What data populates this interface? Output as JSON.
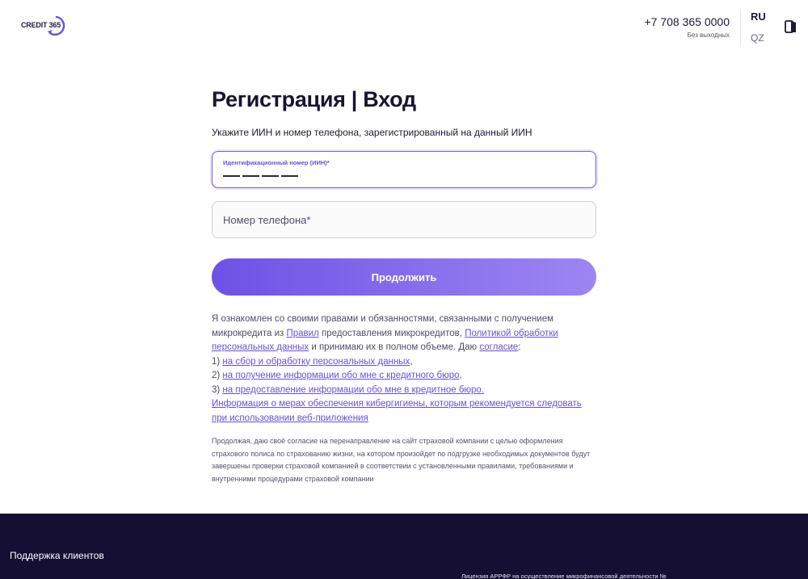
{
  "header": {
    "logo_text": "CREDIT",
    "logo_number": "365",
    "phone_number": "+7 708 365 0000",
    "phone_hours": "Без выходных",
    "lang_ru": "RU",
    "lang_qz": "QZ",
    "icon": "login-door-icon"
  },
  "main": {
    "title": "Регистрация | Вход",
    "subtitle": "Укажите ИИН и номер телефона, зарегистрированный на данный ИИН",
    "iin_label": "Идентификационный номер (ИИН)*",
    "phone_placeholder": "Номер телефона*",
    "continue_button": "Продолжить"
  },
  "consent": {
    "t1": "Я ознакомлен со своими правами и обязанностями, связанными с получением микрокредита из ",
    "link_rules": "Правил",
    "t2": " предоставления микрокредитов, ",
    "link_policy": "Политикой обработки персональных данных",
    "t3": " и принимаю их в полном объеме. Даю ",
    "link_consent": "согласие",
    "t4": ":",
    "item1_num": "1) ",
    "item1_link": "на сбор и обработку персональных данных",
    "item1_end": ",",
    "item2_num": "2) ",
    "item2_link": "на получение информации обо мне с кредитного бюро",
    "item2_end": ",",
    "item3_num": "3) ",
    "item3_link": "на предоставление информации обо мне в кредитное бюро.",
    "cyber_link": "Информация о мерах обеспечения кибергигиены, которым рекомендуется следовать при использовании веб-приложения"
  },
  "insurance_text": "Продолжая, даю своё согласие на перенаправление на сайт страховой компании с целью оформления страхового полиса по страхованию жизни, на котором произойдет по подгрузке необходимых документов будут завершены проверки страховой компанией в соответствии с установленными правилами, требованиями и внутренними процедурами страховой компании",
  "footer": {
    "support_title": "Поддержка клиентов",
    "license_text": "Лицензия АРРФР на осуществление микрофинансовой деятельности №"
  },
  "colors": {
    "accent": "#6d52e6",
    "link": "#6a4fd9",
    "footer_bg": "#140f33"
  }
}
